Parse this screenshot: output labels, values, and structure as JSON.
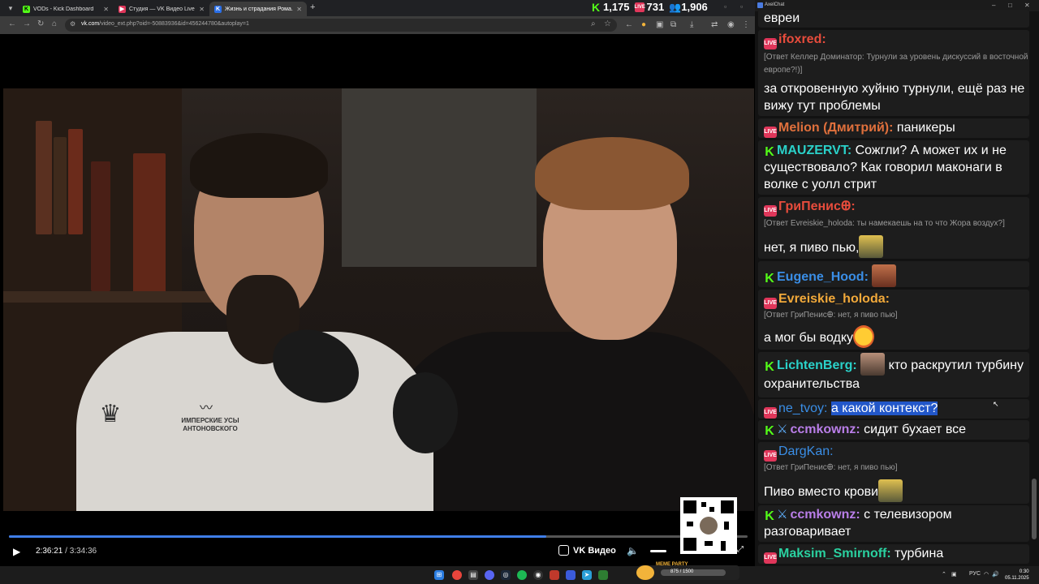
{
  "browser": {
    "tabs": [
      {
        "label": "VODs - Kick Dashboard",
        "icon": "kick-icon",
        "color": "#53fc18"
      },
      {
        "label": "Студия — VK Видео Live",
        "icon": "vk-video-icon",
        "color": "#e0365a"
      },
      {
        "label": "Жизнь и страдания Рома...",
        "icon": "vk-icon",
        "color": "#2a6fe8"
      }
    ],
    "url_host": "vk.com",
    "url_path": "/video_ext.php?oid=-50883936&id=456244780&autoplay=1",
    "counters": [
      {
        "value": "1,175",
        "icon": "kick-icon",
        "color": "#53fc18"
      },
      {
        "value": "731",
        "icon": "vk-live-icon",
        "color": "#e0365a"
      },
      {
        "value": "1,906",
        "icon": "users-icon",
        "color": "#4a7be0"
      }
    ]
  },
  "player": {
    "current_time": "2:36:21",
    "separator": " / ",
    "duration": "3:34:36",
    "progress": 0.728,
    "brand": "VK Видео",
    "shirt_text": "ИМПЕРСКИЕ УСЫ АНТОНОВСКОГО"
  },
  "chat": {
    "window_title": "AxelChat",
    "messages": [
      {
        "text": "евреи"
      },
      {
        "platform": "vk",
        "nick": "ifoxred:",
        "nick_color": "#e74c3c",
        "reply": "[Ответ Келлер Доминатор: Турнули за уровень дискуссий в восточной европе?!)]",
        "text": "за откровенную хуйню турнули, ещё раз не вижу тут проблемы"
      },
      {
        "platform": "vk",
        "nick": "Melion (Дмитрий):",
        "nick_color": "#e0703c",
        "text": "паникеры"
      },
      {
        "platform": "kick",
        "nick": "MAUZERVT:",
        "nick_color": "#2ad1c9",
        "text": "Сожгли? А может их и не существовало? Как говорил маконаги в волке с уолл стрит"
      },
      {
        "platform": "vk",
        "nick": "ГриПенисꚚ:",
        "nick_color": "#e74c3c",
        "reply": "[Ответ Evreiskie_holoda: ты намекаешь на то что Жора воздух?]",
        "text": "нет, я пиво пью,"
      },
      {
        "platform": "kick",
        "nick": "Eugene_Hood:",
        "nick_color": "#3a8ee6",
        "text": ""
      },
      {
        "platform": "vk",
        "nick": "Evreiskie_holoda:",
        "nick_color": "#f2a93a",
        "reply": "[Ответ ГриПенисꚚ: нет, я пиво пью]",
        "text": "а мог бы водку"
      },
      {
        "platform": "kick",
        "nick": "LichtenBerg:",
        "nick_color": "#2ad1c9",
        "text": "кто раскрутил турбину охранительства"
      },
      {
        "platform": "vk",
        "nick": "ne_tvoy:",
        "nick_color": "#3a8ee6",
        "text": "а какой контекст?"
      },
      {
        "platform": "kick",
        "nick": "ccmkownz:",
        "nick_color": "#b97ee8",
        "text": "сидит бухает все"
      },
      {
        "platform": "vk",
        "nick": "DargKan:",
        "nick_color": "#3a8ee6",
        "reply": "[Ответ ГриПенисꚚ: нет, я пиво пью]",
        "text": "Пиво вместо крови"
      },
      {
        "platform": "kick",
        "nick": "ccmkownz:",
        "nick_color": "#b97ee8",
        "text": "с телевизором разговаривает"
      },
      {
        "platform": "vk",
        "nick": "Maksim_Smirnoff:",
        "nick_color": "#2ad1a0",
        "text": "турбина"
      }
    ]
  },
  "taskbar": {
    "meme_label": "MEME PARTY",
    "meme_value": "875 / 1500",
    "lang": "РУС",
    "time": "0:30",
    "date": "05.11.2025"
  }
}
